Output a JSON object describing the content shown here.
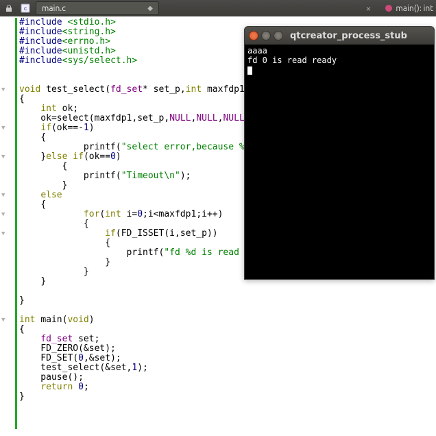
{
  "toolbar": {
    "lock_icon": "lock",
    "file_icon": "c-file",
    "tab_label": "main.c",
    "crumb_icon": "func",
    "crumb_label": "main(): int"
  },
  "code": [
    {
      "t": [
        [
          "pre",
          "#include "
        ],
        [
          "str",
          "<stdio.h>"
        ]
      ]
    },
    {
      "t": [
        [
          "pre",
          "#include"
        ],
        [
          "str",
          "<string.h>"
        ]
      ]
    },
    {
      "t": [
        [
          "pre",
          "#include"
        ],
        [
          "str",
          "<errno.h>"
        ]
      ]
    },
    {
      "t": [
        [
          "pre",
          "#include"
        ],
        [
          "str",
          "<unistd.h>"
        ]
      ]
    },
    {
      "t": [
        [
          "pre",
          "#include"
        ],
        [
          "str",
          "<sys/select.h>"
        ]
      ]
    },
    {
      "t": [
        [
          "",
          ""
        ]
      ]
    },
    {
      "t": [
        [
          "",
          ""
        ]
      ]
    },
    {
      "fold": true,
      "t": [
        [
          "oli",
          "void "
        ],
        [
          "blk",
          "test_select"
        ],
        [
          "br",
          "("
        ],
        [
          "type",
          "fd_set"
        ],
        [
          "blk",
          "* set_p"
        ],
        [
          "br",
          ","
        ],
        [
          "oli",
          "int"
        ],
        [
          "blk",
          " maxfdp1"
        ],
        [
          "br",
          ")"
        ]
      ]
    },
    {
      "t": [
        [
          "br",
          "{"
        ]
      ]
    },
    {
      "t": [
        [
          "blk",
          "    "
        ],
        [
          "oli",
          "int"
        ],
        [
          "blk",
          " ok"
        ],
        [
          "br",
          ";"
        ]
      ]
    },
    {
      "t": [
        [
          "blk",
          "    ok"
        ],
        [
          "br",
          "="
        ],
        [
          "blk",
          "select"
        ],
        [
          "br",
          "("
        ],
        [
          "blk",
          "maxfdp1"
        ],
        [
          "br",
          ","
        ],
        [
          "blk",
          "set_p"
        ],
        [
          "br",
          ","
        ],
        [
          "type",
          "NULL"
        ],
        [
          "br",
          ","
        ],
        [
          "type",
          "NULL"
        ],
        [
          "br",
          ","
        ],
        [
          "type",
          "NULL"
        ],
        [
          "br",
          ");"
        ]
      ]
    },
    {
      "fold": true,
      "t": [
        [
          "blk",
          "    "
        ],
        [
          "oli",
          "if"
        ],
        [
          "br",
          "("
        ],
        [
          "blk",
          "ok"
        ],
        [
          "br",
          "==-"
        ],
        [
          "num",
          "1"
        ],
        [
          "br",
          ")"
        ]
      ]
    },
    {
      "t": [
        [
          "blk",
          "    "
        ],
        [
          "br",
          "{"
        ]
      ]
    },
    {
      "t": [
        [
          "blk",
          "            printf"
        ],
        [
          "br",
          "("
        ],
        [
          "str",
          "\"select error,because %s\\n\""
        ]
      ]
    },
    {
      "fold": true,
      "t": [
        [
          "blk",
          "    "
        ],
        [
          "br",
          "}"
        ],
        [
          "oli",
          "else if"
        ],
        [
          "br",
          "("
        ],
        [
          "blk",
          "ok"
        ],
        [
          "br",
          "=="
        ],
        [
          "num",
          "0"
        ],
        [
          "br",
          ")"
        ]
      ]
    },
    {
      "t": [
        [
          "blk",
          "        "
        ],
        [
          "br",
          "{"
        ]
      ]
    },
    {
      "t": [
        [
          "blk",
          "            printf"
        ],
        [
          "br",
          "("
        ],
        [
          "str",
          "\"Timeout\\n\""
        ],
        [
          "br",
          ");"
        ]
      ]
    },
    {
      "t": [
        [
          "blk",
          "        "
        ],
        [
          "br",
          "}"
        ]
      ]
    },
    {
      "fold": true,
      "t": [
        [
          "blk",
          "    "
        ],
        [
          "oli",
          "else"
        ]
      ]
    },
    {
      "t": [
        [
          "blk",
          "    "
        ],
        [
          "br",
          "{"
        ]
      ]
    },
    {
      "fold": true,
      "t": [
        [
          "blk",
          "            "
        ],
        [
          "oli",
          "for"
        ],
        [
          "br",
          "("
        ],
        [
          "oli",
          "int"
        ],
        [
          "blk",
          " i"
        ],
        [
          "br",
          "="
        ],
        [
          "num",
          "0"
        ],
        [
          "br",
          ";"
        ],
        [
          "blk",
          "i"
        ],
        [
          "br",
          "<"
        ],
        [
          "blk",
          "maxfdp1"
        ],
        [
          "br",
          ";"
        ],
        [
          "blk",
          "i"
        ],
        [
          "br",
          "++)"
        ]
      ]
    },
    {
      "t": [
        [
          "blk",
          "            "
        ],
        [
          "br",
          "{"
        ]
      ]
    },
    {
      "fold": true,
      "t": [
        [
          "blk",
          "                "
        ],
        [
          "oli",
          "if"
        ],
        [
          "br",
          "("
        ],
        [
          "blk",
          "FD_ISSET"
        ],
        [
          "br",
          "("
        ],
        [
          "blk",
          "i"
        ],
        [
          "br",
          ","
        ],
        [
          "blk",
          "set_p"
        ],
        [
          "br",
          "))"
        ]
      ]
    },
    {
      "t": [
        [
          "blk",
          "                "
        ],
        [
          "br",
          "{"
        ]
      ]
    },
    {
      "t": [
        [
          "blk",
          "                    printf"
        ],
        [
          "br",
          "("
        ],
        [
          "str",
          "\"fd %d is read read"
        ]
      ]
    },
    {
      "t": [
        [
          "blk",
          "                "
        ],
        [
          "br",
          "}"
        ]
      ]
    },
    {
      "t": [
        [
          "blk",
          "            "
        ],
        [
          "br",
          "}"
        ]
      ]
    },
    {
      "t": [
        [
          "blk",
          "    "
        ],
        [
          "br",
          "}"
        ]
      ]
    },
    {
      "t": [
        [
          "",
          ""
        ]
      ]
    },
    {
      "t": [
        [
          "br",
          "}"
        ]
      ]
    },
    {
      "t": [
        [
          "",
          ""
        ]
      ]
    },
    {
      "fold": true,
      "t": [
        [
          "oli",
          "int "
        ],
        [
          "blk",
          "main"
        ],
        [
          "br",
          "("
        ],
        [
          "oli",
          "void"
        ],
        [
          "br",
          ")"
        ]
      ]
    },
    {
      "t": [
        [
          "br",
          "{"
        ]
      ]
    },
    {
      "t": [
        [
          "blk",
          "    "
        ],
        [
          "type",
          "fd_set"
        ],
        [
          "blk",
          " set"
        ],
        [
          "br",
          ";"
        ]
      ]
    },
    {
      "t": [
        [
          "blk",
          "    FD_ZERO"
        ],
        [
          "br",
          "(&"
        ],
        [
          "blk",
          "set"
        ],
        [
          "br",
          ");"
        ]
      ]
    },
    {
      "t": [
        [
          "blk",
          "    FD_SET"
        ],
        [
          "br",
          "("
        ],
        [
          "num",
          "0"
        ],
        [
          "br",
          ",&"
        ],
        [
          "blk",
          "set"
        ],
        [
          "br",
          ");"
        ]
      ]
    },
    {
      "t": [
        [
          "blk",
          "    test_select"
        ],
        [
          "br",
          "(&"
        ],
        [
          "blk",
          "set"
        ],
        [
          "br",
          ","
        ],
        [
          "num",
          "1"
        ],
        [
          "br",
          ");"
        ]
      ]
    },
    {
      "t": [
        [
          "blk",
          "    pause"
        ],
        [
          "br",
          "();"
        ]
      ]
    },
    {
      "t": [
        [
          "blk",
          "    "
        ],
        [
          "oli",
          "return"
        ],
        [
          "blk",
          " "
        ],
        [
          "num",
          "0"
        ],
        [
          "br",
          ";"
        ]
      ]
    },
    {
      "t": [
        [
          "br",
          "}"
        ]
      ]
    }
  ],
  "terminal": {
    "title": "qtcreator_process_stub",
    "lines": [
      "aaaa",
      "fd 0 is read ready"
    ]
  }
}
